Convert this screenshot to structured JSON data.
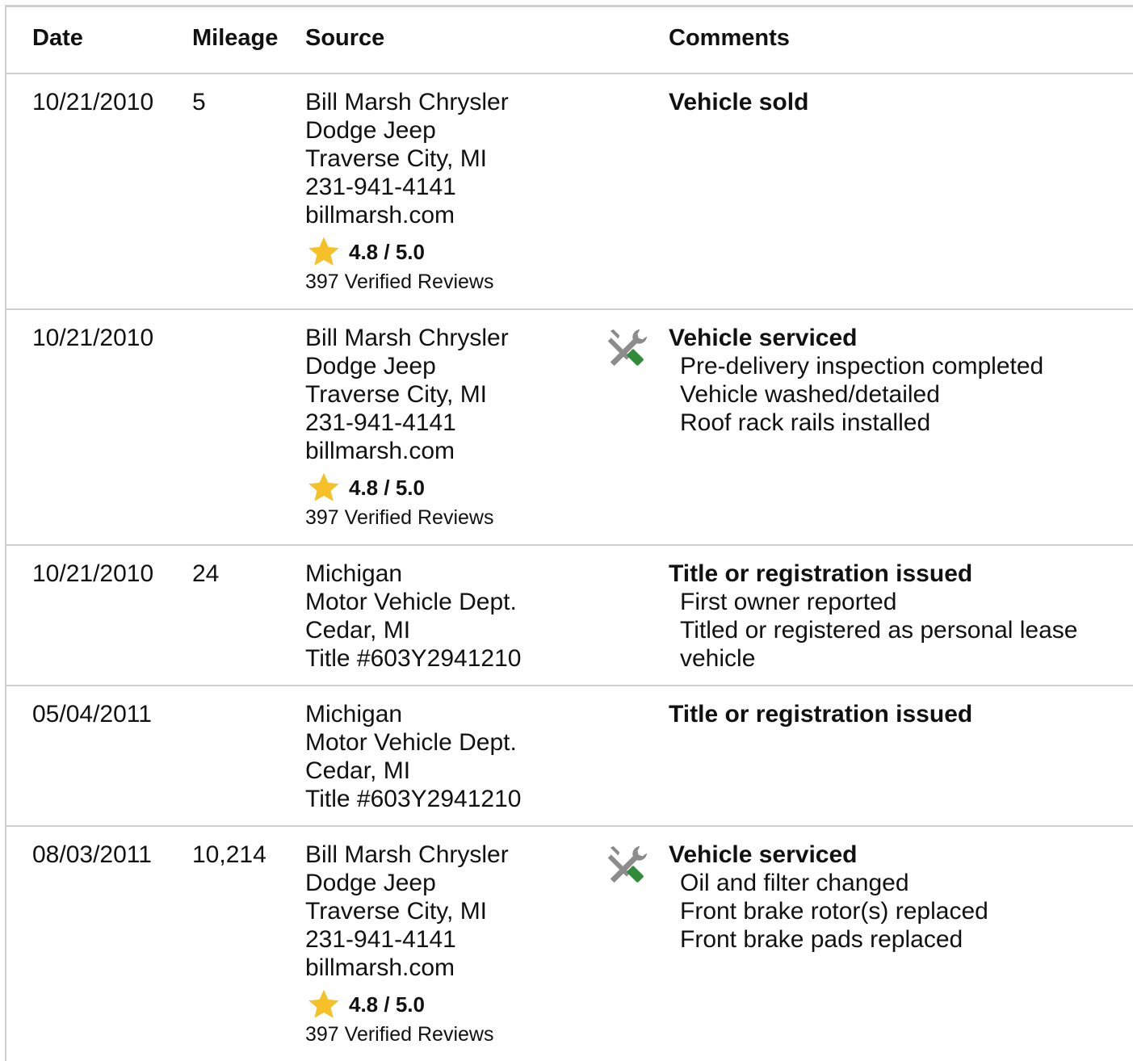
{
  "table": {
    "headers": {
      "date": "Date",
      "mileage": "Mileage",
      "source": "Source",
      "comments": "Comments"
    },
    "rows": [
      {
        "date": "10/21/2010",
        "mileage": "5",
        "source": [
          "Bill Marsh Chrysler",
          "Dodge Jeep",
          "Traverse City, MI",
          "231-941-4141",
          "billmarsh.com"
        ],
        "rating": "4.8 / 5.0",
        "reviews": "397 Verified Reviews",
        "icon": "",
        "comment_title": "Vehicle sold",
        "comment_details": []
      },
      {
        "date": "10/21/2010",
        "mileage": "",
        "source": [
          "Bill Marsh Chrysler",
          "Dodge Jeep",
          "Traverse City, MI",
          "231-941-4141",
          "billmarsh.com"
        ],
        "rating": "4.8 / 5.0",
        "reviews": "397 Verified Reviews",
        "icon": "wrench-screwdriver-icon",
        "comment_title": "Vehicle serviced",
        "comment_details": [
          "Pre-delivery inspection completed",
          "Vehicle washed/detailed",
          "Roof rack rails installed"
        ]
      },
      {
        "date": "10/21/2010",
        "mileage": "24",
        "source": [
          "Michigan",
          "Motor Vehicle Dept.",
          "Cedar, MI",
          "Title #603Y2941210"
        ],
        "rating": "",
        "reviews": "",
        "icon": "",
        "comment_title": "Title or registration issued",
        "comment_details": [
          "First owner reported",
          "Titled or registered as personal lease",
          "vehicle"
        ]
      },
      {
        "date": "05/04/2011",
        "mileage": "",
        "source": [
          "Michigan",
          "Motor Vehicle Dept.",
          "Cedar, MI",
          "Title #603Y2941210"
        ],
        "rating": "",
        "reviews": "",
        "icon": "",
        "comment_title": "Title or registration issued",
        "comment_details": []
      },
      {
        "date": "08/03/2011",
        "mileage": "10,214",
        "source": [
          "Bill Marsh Chrysler",
          "Dodge Jeep",
          "Traverse City, MI",
          "231-941-4141",
          "billmarsh.com"
        ],
        "rating": "4.8 / 5.0",
        "reviews": "397 Verified Reviews",
        "icon": "wrench-screwdriver-icon",
        "comment_title": "Vehicle serviced",
        "comment_details": [
          "Oil and filter changed",
          "Front brake rotor(s) replaced",
          "Front brake pads replaced"
        ]
      }
    ]
  },
  "colors": {
    "star": "#f6c028",
    "tool_gray": "#8c8c8c",
    "tool_green": "#2e8b3a",
    "border": "#cfcfcf"
  }
}
